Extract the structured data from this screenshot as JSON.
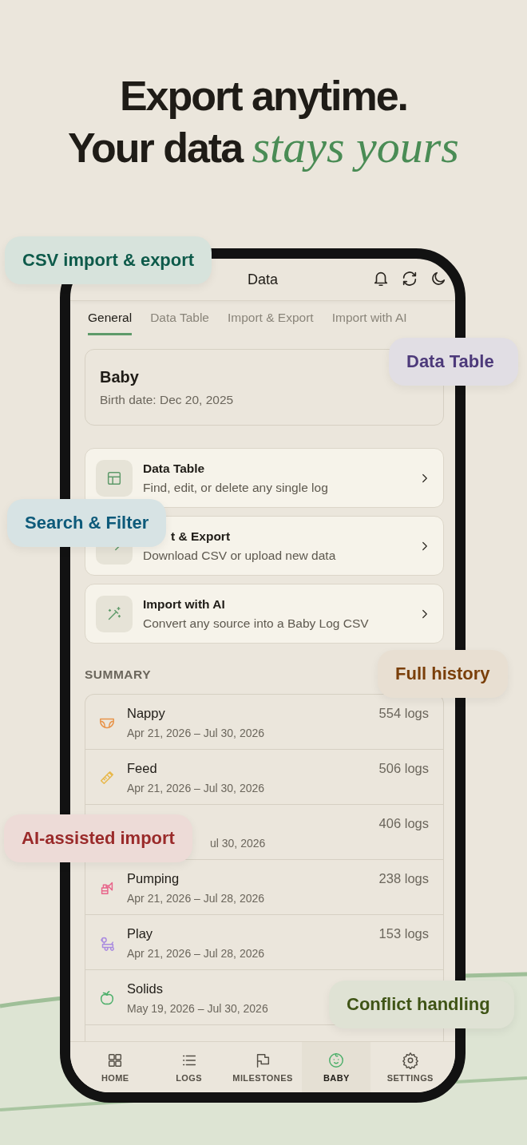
{
  "headline": {
    "line_1": "Export anytime.",
    "line_2": "Your data *stays yours*"
  },
  "screen": {
    "title": "Data",
    "tabs": [
      {
        "label": "General",
        "selected": true
      },
      {
        "label": "Data Table",
        "selected": false
      },
      {
        "label": "Import & Export",
        "selected": false
      },
      {
        "label": "Import with AI",
        "selected": false
      }
    ],
    "profile": {
      "name": "Baby",
      "birth_date": "Birth date: Dec 20, 2025"
    },
    "menu": [
      {
        "kind": "table",
        "title": "Data Table",
        "subtitle": "Find, edit, or delete any single log",
        "covered": false
      },
      {
        "kind": "arrow",
        "title": "t & Export",
        "subtitle": "Download CSV or upload new data",
        "covered": true
      },
      {
        "kind": "wand",
        "title": "Import with AI",
        "subtitle": "Convert any source into a Baby Log CSV",
        "covered": false
      }
    ],
    "summary_heading": "SUMMARY",
    "summary": [
      {
        "kind": "nappy",
        "color": "#e8944a",
        "name": "Nappy",
        "dates": "Apr 21, 2026 – Jul 30, 2026",
        "count": "554 logs"
      },
      {
        "kind": "bottle",
        "color": "#e8b84a",
        "name": "Feed",
        "dates": "Apr 21, 2026 – Jul 30, 2026",
        "count": "506 logs"
      },
      {
        "dates": "ul 30, 2026",
        "count": "406 logs",
        "covered": true
      },
      {
        "kind": "pump",
        "color": "#e8648a",
        "name": "Pumping",
        "dates": "Apr 21, 2026 – Jul 28, 2026",
        "count": "238 logs"
      },
      {
        "kind": "toy",
        "color": "#a98ae0",
        "name": "Play",
        "dates": "Apr 21, 2026 – Jul 28, 2026",
        "count": "153 logs"
      },
      {
        "kind": "apple",
        "color": "#4caf6a",
        "name": "Solids",
        "dates": "May 19, 2026 – Jul 30, 2026"
      }
    ],
    "nav": [
      {
        "kind": "grid",
        "label": "HOME",
        "selected": false
      },
      {
        "kind": "list",
        "label": "LOGS",
        "selected": false
      },
      {
        "kind": "flag",
        "label": "MILESTONES",
        "selected": false
      },
      {
        "kind": "baby",
        "label": "BABY",
        "selected": true
      },
      {
        "kind": "gear",
        "label": "SETTINGS",
        "selected": false
      }
    ]
  },
  "callouts": [
    {
      "label": "CSV import & export",
      "color": "#0d5a4a"
    },
    {
      "label": "Data Table",
      "color": "#4d3a7a"
    },
    {
      "label": "Search & Filter",
      "color": "#0d5a7a"
    },
    {
      "label": "Full history",
      "color": "#7a3f0a"
    },
    {
      "label": "AI-assisted import",
      "color": "#9a2a2a"
    },
    {
      "label": "Conflict handling",
      "color": "#3f5416"
    }
  ]
}
